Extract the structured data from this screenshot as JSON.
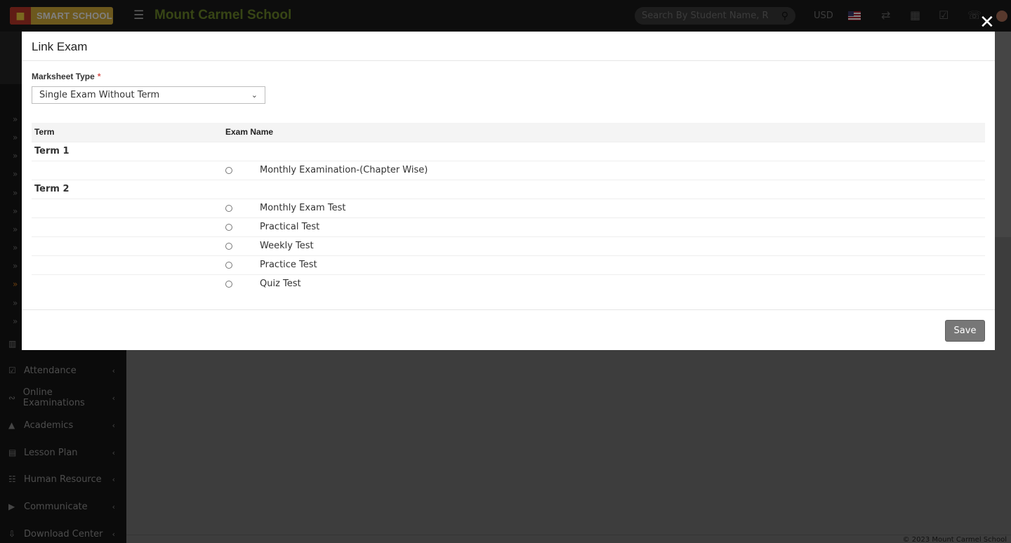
{
  "app": {
    "logo_text": "SMART SCHOOL",
    "school_name": "Mount Carmel School",
    "search_placeholder": "Search By Student Name, Roll Number, Enroll Number",
    "currency": "USD"
  },
  "sidebar": {
    "items": [
      {
        "label": "",
        "icon": "map-icon"
      },
      {
        "label": "Attendance",
        "icon": "calendar-check-icon"
      },
      {
        "label": "Online Examinations",
        "icon": "rss-icon"
      },
      {
        "label": "Academics",
        "icon": "graduation-cap-icon"
      },
      {
        "label": "Lesson Plan",
        "icon": "list-icon"
      },
      {
        "label": "Human Resource",
        "icon": "sitemap-icon"
      },
      {
        "label": "Communicate",
        "icon": "bullhorn-icon"
      },
      {
        "label": "Download Center",
        "icon": "download-icon"
      }
    ]
  },
  "footer": {
    "copyright": "© 2023 Mount Carmel School"
  },
  "modal": {
    "title": "Link Exam",
    "marksheet_label": "Marksheet Type",
    "required_mark": "*",
    "marksheet_value": "Single Exam Without Term",
    "table_headers": {
      "term": "Term",
      "exam_name": "Exam Name"
    },
    "terms": [
      {
        "name": "Term 1",
        "exams": [
          "Monthly Examination-(Chapter Wise)"
        ]
      },
      {
        "name": "Term 2",
        "exams": [
          "Monthly Exam Test",
          "Practical Test",
          "Weekly Test",
          "Practice Test",
          "Quiz Test"
        ]
      }
    ],
    "save_label": "Save",
    "close_symbol": "✕"
  }
}
